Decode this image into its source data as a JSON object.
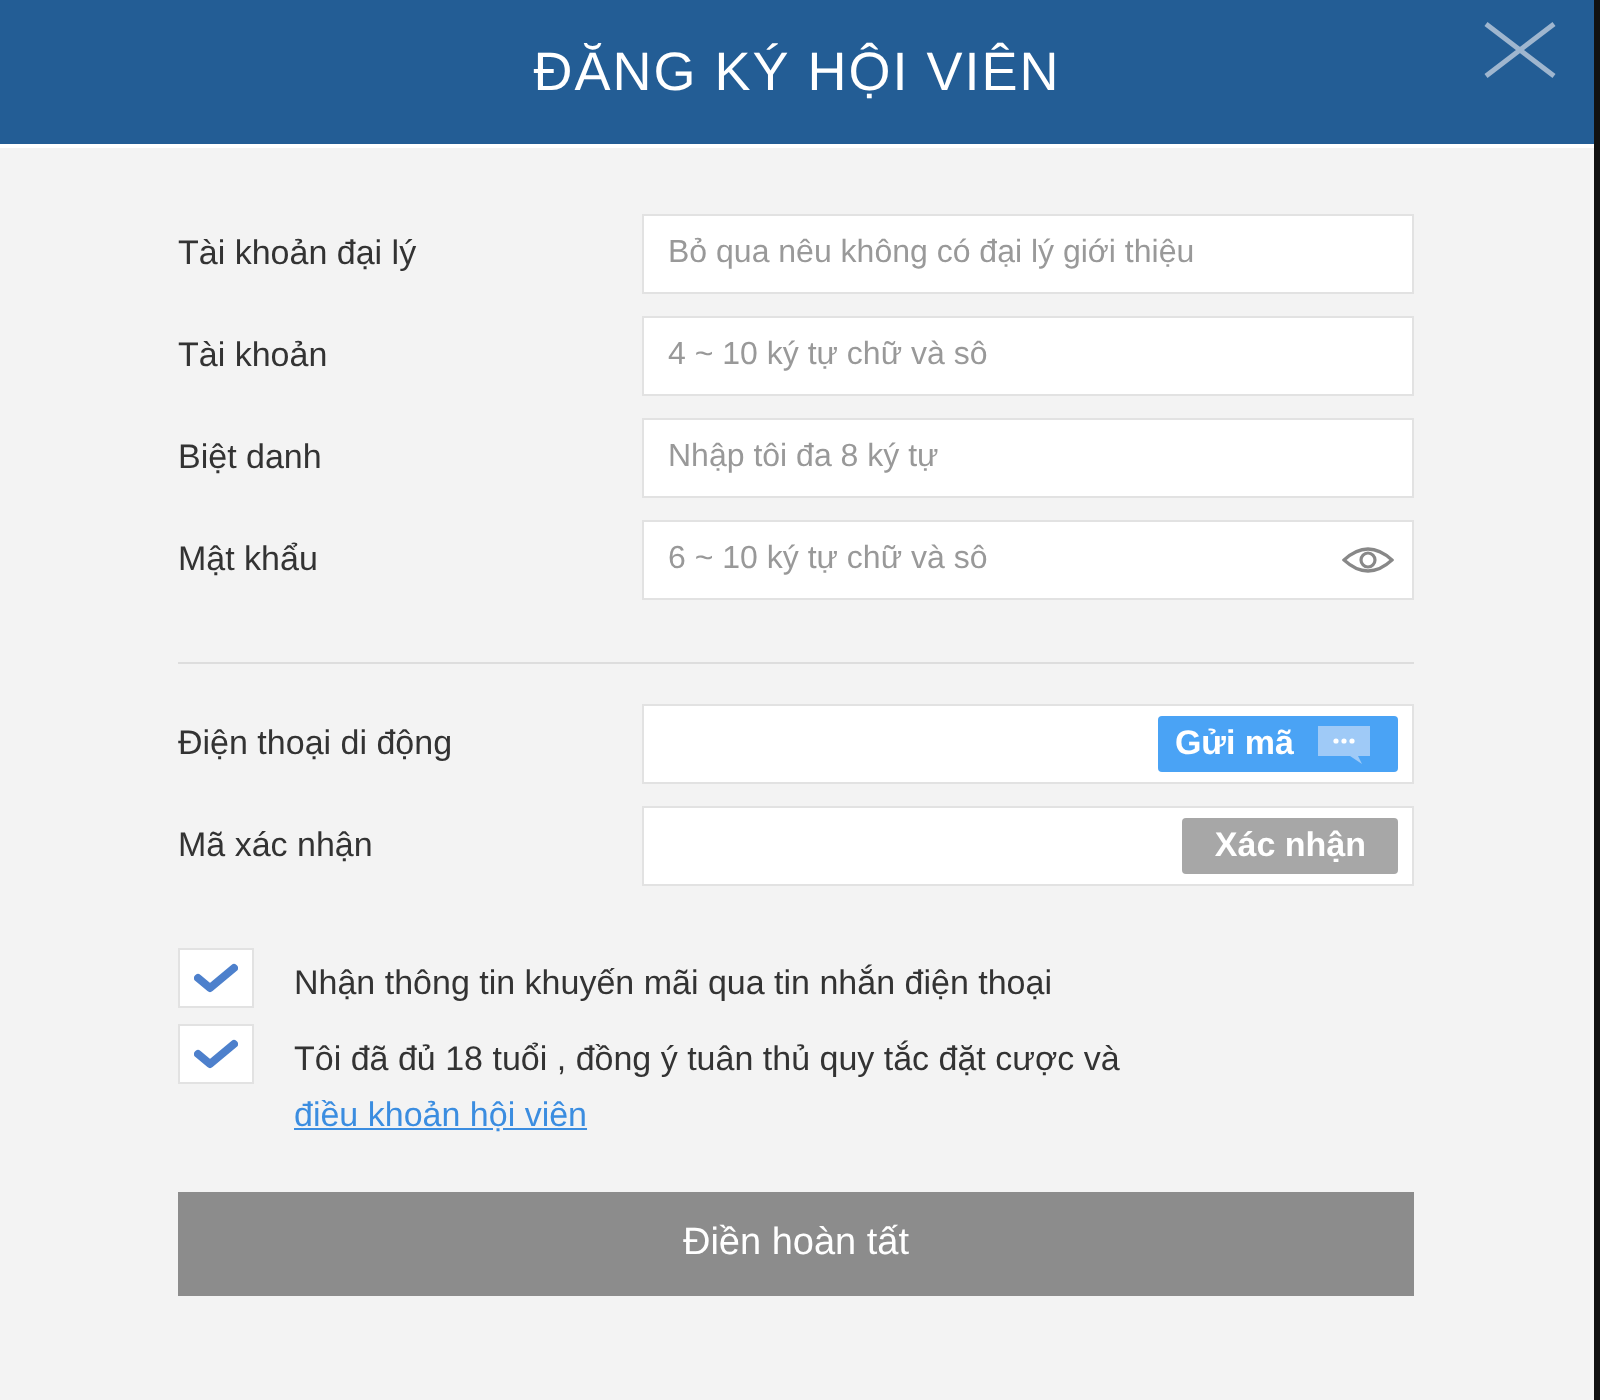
{
  "dialog": {
    "title": "ĐĂNG KÝ HỘI VIÊN"
  },
  "account_fields": [
    {
      "label": "Tài khoản đại lý",
      "placeholder": "Bỏ qua nêu không có đại lý giới thiệu",
      "kind": "text"
    },
    {
      "label": "Tài khoản",
      "placeholder": "4 ~ 10 ký tự chữ và sô",
      "kind": "text"
    },
    {
      "label": "Biệt danh",
      "placeholder": "Nhập tôi đa 8 ký tự",
      "kind": "text"
    },
    {
      "label": "Mật khẩu",
      "placeholder": "6 ~ 10 ký tự chữ và sô",
      "kind": "password"
    }
  ],
  "phone_fields": [
    {
      "label": "Điện thoại di động",
      "button": "Gửi mã",
      "kind": "send",
      "disabled": false
    },
    {
      "label": "Mã xác nhận",
      "button": "Xác nhận",
      "kind": "verify",
      "disabled": true
    }
  ],
  "agreements": [
    {
      "text": "Nhận thông tin khuyến mãi qua tin nhắn điện thoại",
      "checked": true
    },
    {
      "text": "Tôi đã đủ 18 tuổi , đồng ý tuân thủ quy tắc đặt cược và",
      "link": "điều khoản hội viên",
      "checked": true
    }
  ],
  "submit_button": "Điền hoàn tất"
}
